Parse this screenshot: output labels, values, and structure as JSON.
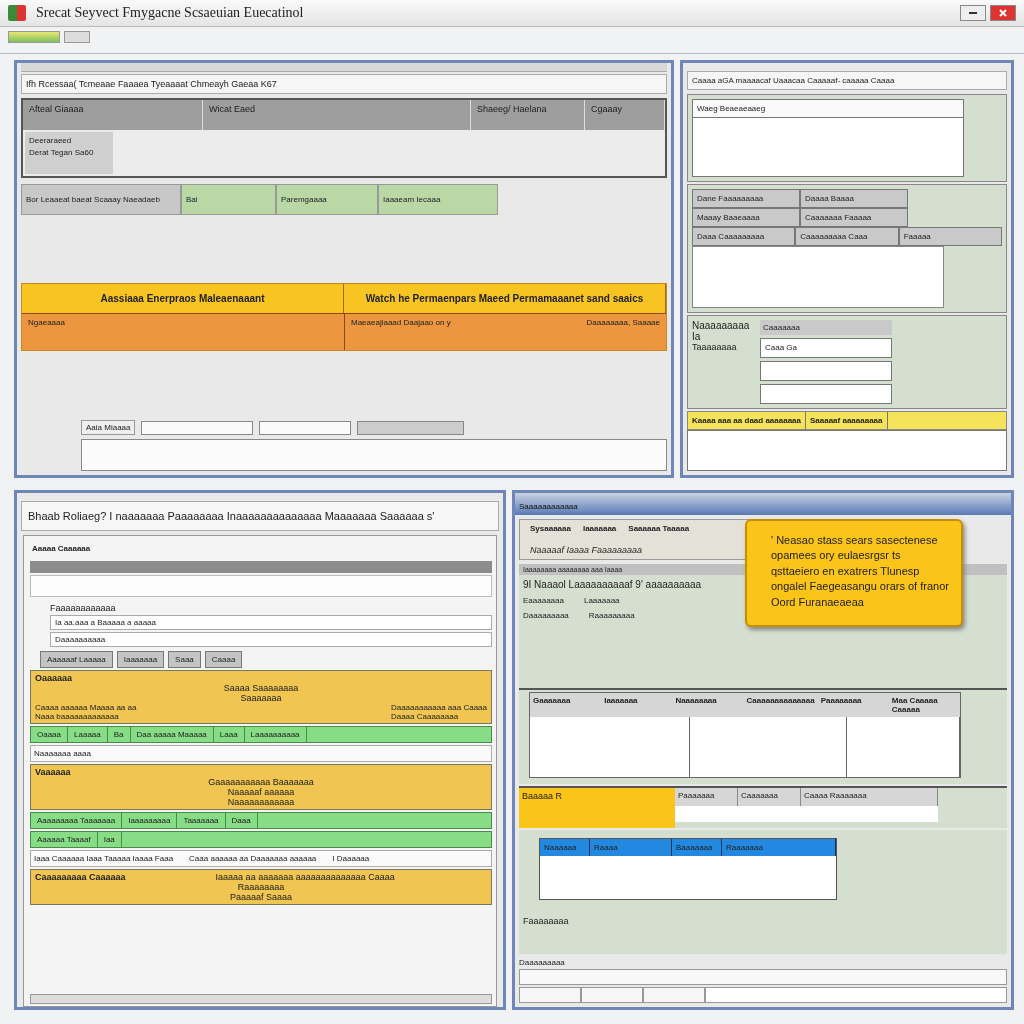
{
  "window": {
    "title": "Srecat Seyvect Fmygacne Scsaeuian Euecatinol"
  },
  "top_left": {
    "title": "Ifh Rcessaa( Tcmeaae Faaaea Tyeaaaat Chmeayh Gaeaa K67",
    "header_cells": [
      "Afteal Giaaaa",
      "Wicat Eaed",
      "Shaeeg/ Haelana",
      "Cgaaay"
    ],
    "side_note": [
      "Deeraraeed",
      "Derat Tegan Sa60"
    ],
    "green_row": [
      {
        "text": "Bor Leaaeat baeat Scaaay Naeadaeb",
        "kind": "grey"
      },
      {
        "text": "Bai",
        "kind": "green"
      },
      {
        "text": "Paremgaaaa",
        "kind": "green"
      },
      {
        "text": "Iaaaeam Iecaaa",
        "kind": "green"
      }
    ],
    "band_headers": [
      "Aassiaaa Enerpraos Maleaenaaant",
      "Watch he Permaenpars Maeed Permamaaanet sand saaics"
    ],
    "band_cells": [
      "Ngaeaaaa",
      "Maeaeajiaaad Daajaao on y",
      "Daaaaaaaa, Saaaae"
    ],
    "form_label": "Aaia Miaaaa"
  },
  "top_right": {
    "title": "Caaaa aGA maaaacaf Uaaacaa Caaaaaf- caaaaa Caaaa",
    "list_header": "Waeg Beaeaeaaeg",
    "grid": [
      [
        "Dane Faaaaaaaaa",
        "Daaaa Baaaa"
      ],
      [
        "Maaay Baaeaaaa",
        "Caaaaaaa Faaaaa"
      ],
      [
        "Daaa Caaaaaaaaa",
        "Caaaaaaaaa Caaa",
        "Faaaaa"
      ]
    ],
    "section_label": "Naaaaaaaaa Ia",
    "section_sub": "Taaaaaaaa",
    "list_header_2": "Caaaaaaa",
    "list_items": [
      "Caaa Ga"
    ],
    "yellow_headers": [
      "Kaaaa aaa aa daad aaaaaaaa",
      "Saaaaaf aaaaaaaaa"
    ]
  },
  "bottom_left": {
    "title": "Bhaab Roliaeg? I naaaaaaa Paaaaaaaa Inaaaaaaaaaaaaaa Maaaaaaa Saaaaaa s'",
    "subtitle": "Aaaaa Caaaaaa",
    "field_label": "Faaaaaaaaaaaa",
    "field_value": "Ia aa.aaa a Baaaaa a aaaaa",
    "field_value_2": "Daaaaaaaaaa",
    "tabs": [
      "Aaaaaaf Laaaaa",
      "Iaaaaaaa",
      "Saaa",
      "Caaaa"
    ],
    "rows": [
      {
        "kind": "yellow",
        "label": "Oaaaaaa",
        "lines": [
          "Saaaa Saaaaaaaa",
          "Saaaaaaa"
        ],
        "left": [
          "Caaaa aaaaaa Maaaa aa aa",
          "Naaa baaaaaaaaaaaaa"
        ],
        "right": [
          "Daaaaaaaaaaa aaa Caaaa",
          "Daaaa Caaaaaaaa"
        ]
      },
      {
        "kind": "green",
        "cells": [
          "Oaaaa",
          "Laaaaa",
          "Ba",
          "Daa aaaaa Maaaaa",
          "Laaa",
          "Laaaaaaaaaa"
        ]
      },
      {
        "kind": "plain",
        "cells": [
          "Naaaaaaa aaaa"
        ]
      },
      {
        "kind": "yellow",
        "label": "Vaaaaaa",
        "lines": [
          "Gaaaaaaaaaaa Baaaaaaa",
          "Naaaaaf aaaaaa",
          "Naaaaaaaaaaaa"
        ]
      },
      {
        "kind": "green",
        "cells": [
          "Aaaaaaaaa Taaaaaaa",
          "Iaaaaaaaaa",
          "Taaaaaaa",
          "Daaa"
        ]
      },
      {
        "kind": "green",
        "cells": [
          "Aaaaaa Taaaaf",
          "Iaa"
        ]
      },
      {
        "kind": "plain",
        "cells": [
          "Iaaa Caaaaaa Iaaa Taaaaa Iaaaa Faaa",
          "Caaa aaaaaa aa Daaaaaaa aaaaaa",
          "I Daaaaaa"
        ]
      },
      {
        "kind": "yellow",
        "label": "Caaaaaaaaa Caaaaaa",
        "header": "Iaaaaa aa aaaaaaa aaaaaaaaaaaaaa Caaaa",
        "lines": [
          "Raaaaaaaa",
          "Paaaaaf Saaaa"
        ]
      }
    ]
  },
  "bottom_right": {
    "title": "Saaaaaaaaaaaa",
    "tabs": [
      "Sysaaaaaa",
      "Iaaaaaaa",
      "Saaaaaa Taaaaa"
    ],
    "subtitle": "Naaaaaf Iaaaa Faaaaaaaaa",
    "bar_label": "Iaaaaaaaa aaaaaaaa aaa Iaaaa",
    "list_title": "9I Naaaol Laaaaaaaaaaf 9' aaaaaaaaaa",
    "list_items": [
      [
        "Eaaaaaaaa",
        "Laaaaaaa"
      ],
      [
        "Daaaaaaaaa",
        "Raaaaaaaaa"
      ]
    ],
    "note": "' Neasao stass sears sasectenese opamees ory eulaesrgsr ts qsttaeiero en exatrers Tlunesp ongalel Faegeasangu orars of franor Oord Furanaeaeaa",
    "table_headers": [
      "Gaaaaaaa",
      "Iaaaaaaa",
      "Naaaaaaaa",
      "Caaaaaaaaaaaaaa",
      "Paaaaaaaa",
      "Maa Caaaaa Caaaaa"
    ],
    "yellow_cell": "Baaaaa R",
    "small_headers": [
      "Paaaaaaa",
      "Caaaaaaa",
      "Caaaa Raaaaaaa"
    ],
    "blue_headers": [
      "Naaaaaa",
      "Raaaa",
      "Baaaaaaa",
      "Raaaaaaa"
    ],
    "footer_label": "Faaaaaaaa",
    "status_title": "Daaaaaaaaa"
  }
}
